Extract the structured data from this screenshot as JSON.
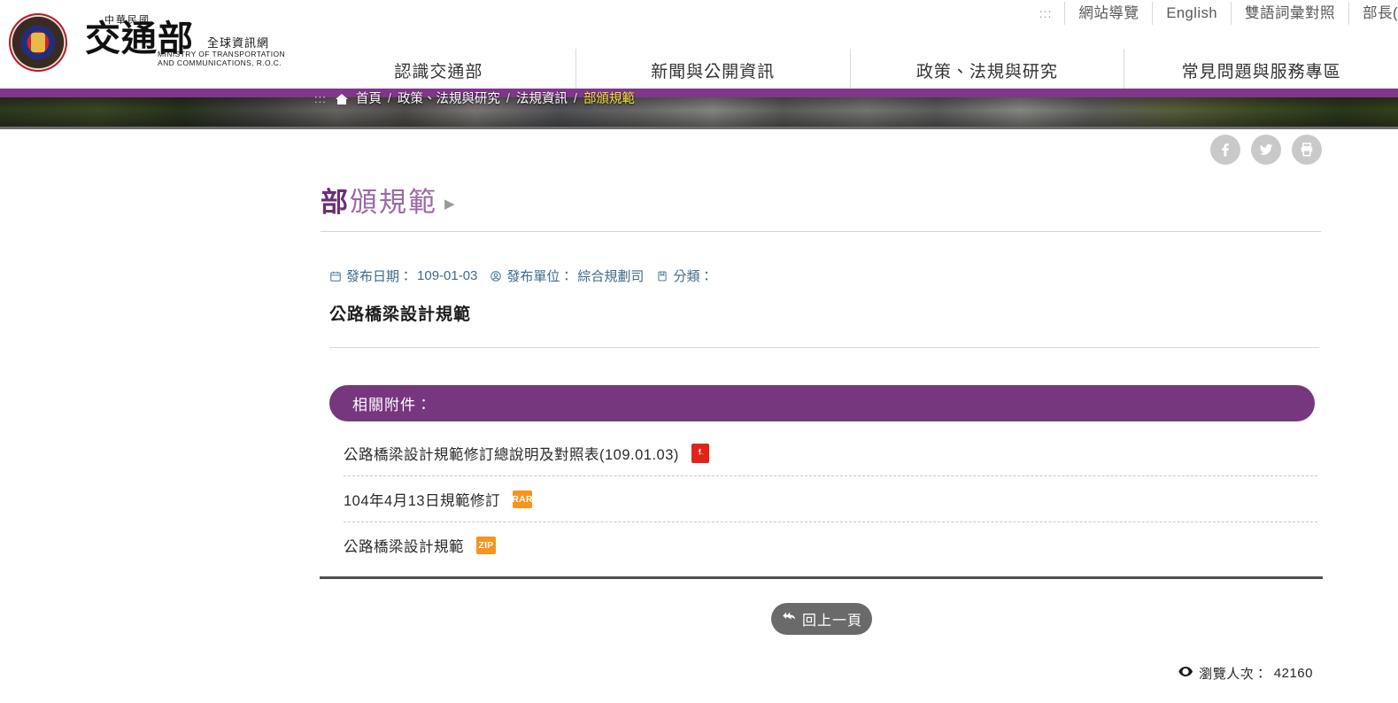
{
  "site": {
    "logo": {
      "small_text": "中華民國",
      "big_text": "交通部",
      "sub_cn": "全球資訊網",
      "sub_en": "MINISTRY OF TRANSPORTATION\nAND COMMUNICATIONS, R.O.C.",
      "emblem_name": "motc-emblem"
    },
    "accessibility_anchor": ":::",
    "top_links": [
      {
        "label": "網站導覽"
      },
      {
        "label": "English"
      },
      {
        "label": "雙語詞彙對照"
      },
      {
        "label": "部長("
      }
    ],
    "main_nav": [
      {
        "label": "認識交通部"
      },
      {
        "label": "新聞與公開資訊"
      },
      {
        "label": "政策、法規與研究"
      },
      {
        "label": "常見問題與服務專區"
      }
    ]
  },
  "breadcrumb": {
    "anchor": ":::",
    "home_label": "首頁",
    "separator": "/",
    "items": [
      {
        "label": "政策、法規與研究",
        "current": false
      },
      {
        "label": "法規資訊",
        "current": false
      },
      {
        "label": "部頒規範",
        "current": true
      }
    ]
  },
  "share": {
    "buttons": [
      {
        "icon": "facebook-icon",
        "label": "Facebook"
      },
      {
        "icon": "twitter-icon",
        "label": "Twitter"
      },
      {
        "icon": "print-icon",
        "label": "列印"
      }
    ]
  },
  "page": {
    "title_strong": "部",
    "title_rest": "頒規範",
    "title_arrow": "▶"
  },
  "meta": {
    "date_icon": "calendar-icon",
    "date_label": "發布日期：",
    "date_value": "109-01-03",
    "unit_icon": "user-circle-icon",
    "unit_label": "發布單位：",
    "unit_value": "綜合規劃司",
    "category_icon": "tag-icon",
    "category_label": "分類：",
    "category_value": ""
  },
  "document": {
    "title": "公路橋梁設計規範"
  },
  "attachments": {
    "heading": "相關附件：",
    "items": [
      {
        "name": "公路橋梁設計規範修訂總說明及對照表(109.01.03)",
        "filetype": "PDF",
        "icon": "pdf-icon"
      },
      {
        "name": "104年4月13日規範修訂",
        "filetype": "RAR",
        "icon": "rar-icon"
      },
      {
        "name": "公路橋梁設計規範",
        "filetype": "ZIP",
        "icon": "zip-icon"
      }
    ]
  },
  "footer": {
    "back_button": "回上一頁",
    "back_icon": "reply-arrow-icon",
    "views_icon": "eye-icon",
    "views_label": "瀏覽人次：",
    "views_value": "42160"
  },
  "colors": {
    "brand_purple": "#80368a",
    "banner_purple": "#77377f",
    "title_strong": "#6b2e78",
    "title_rest": "#9a6aa6",
    "breadcrumb_current": "#f2e43c",
    "archive_badge": "#f7941e",
    "pdf_badge": "#e2231a",
    "meta_text": "#3f6a8a"
  }
}
